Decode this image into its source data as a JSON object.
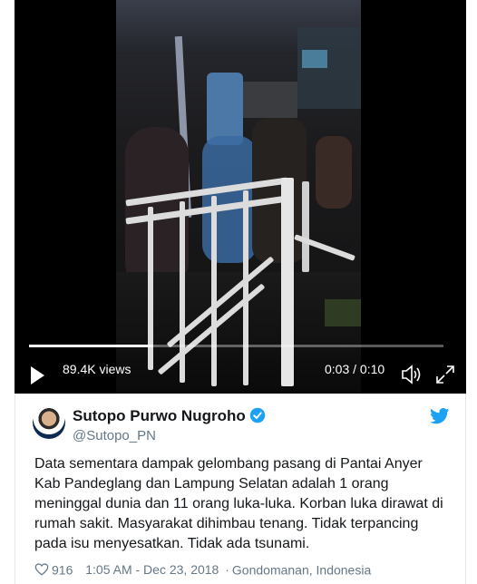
{
  "video": {
    "views": "89.4K views",
    "time": "0:03 / 0:10",
    "progress": 0.3
  },
  "tweet": {
    "author_name": "Sutopo Purwo Nugroho",
    "handle": "@Sutopo_PN",
    "text": "Data sementara dampak gelombang pasang di Pantai Anyer Kab Pandeglang dan Lampung Selatan adalah 1 orang meninggal dunia dan 11 orang luka-luka. Korban luka dirawat di rumah sakit. Masyarakat dihimbau tenang. Tidak terpancing pada isu menyesatkan. Tidak ada tsunami.",
    "likes": "916",
    "timestamp": "1:05 AM - Dec 23, 2018",
    "location": "Gondomanan, Indonesia",
    "separator": "·"
  },
  "icons": {
    "play": "play-icon",
    "volume": "volume-icon",
    "fullscreen": "fullscreen-icon",
    "verified": "verified-badge-icon",
    "twitter": "twitter-bird-icon",
    "like": "heart-icon"
  },
  "colors": {
    "brand_blue": "#1da1f2",
    "text": "#14171a",
    "muted": "#657786"
  }
}
